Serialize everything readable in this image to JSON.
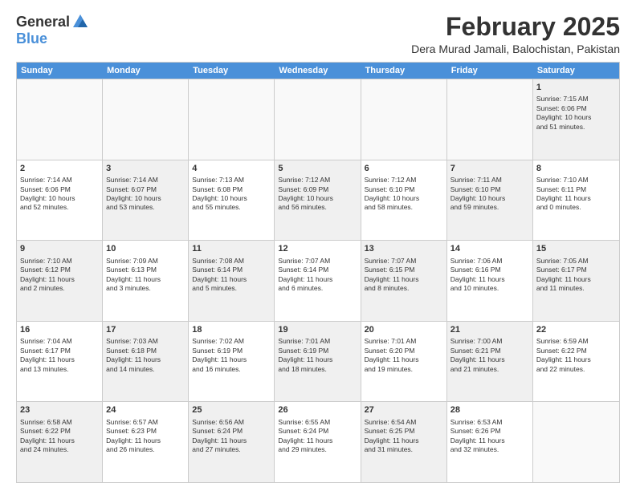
{
  "logo": {
    "general": "General",
    "blue": "Blue"
  },
  "title": "February 2025",
  "subtitle": "Dera Murad Jamali, Balochistan, Pakistan",
  "headers": [
    "Sunday",
    "Monday",
    "Tuesday",
    "Wednesday",
    "Thursday",
    "Friday",
    "Saturday"
  ],
  "rows": [
    [
      {
        "day": "",
        "text": "",
        "empty": true
      },
      {
        "day": "",
        "text": "",
        "empty": true
      },
      {
        "day": "",
        "text": "",
        "empty": true
      },
      {
        "day": "",
        "text": "",
        "empty": true
      },
      {
        "day": "",
        "text": "",
        "empty": true
      },
      {
        "day": "",
        "text": "",
        "empty": true
      },
      {
        "day": "1",
        "text": "Sunrise: 7:15 AM\nSunset: 6:06 PM\nDaylight: 10 hours\nand 51 minutes.",
        "shaded": true
      }
    ],
    [
      {
        "day": "2",
        "text": "Sunrise: 7:14 AM\nSunset: 6:06 PM\nDaylight: 10 hours\nand 52 minutes."
      },
      {
        "day": "3",
        "text": "Sunrise: 7:14 AM\nSunset: 6:07 PM\nDaylight: 10 hours\nand 53 minutes.",
        "shaded": true
      },
      {
        "day": "4",
        "text": "Sunrise: 7:13 AM\nSunset: 6:08 PM\nDaylight: 10 hours\nand 55 minutes."
      },
      {
        "day": "5",
        "text": "Sunrise: 7:12 AM\nSunset: 6:09 PM\nDaylight: 10 hours\nand 56 minutes.",
        "shaded": true
      },
      {
        "day": "6",
        "text": "Sunrise: 7:12 AM\nSunset: 6:10 PM\nDaylight: 10 hours\nand 58 minutes."
      },
      {
        "day": "7",
        "text": "Sunrise: 7:11 AM\nSunset: 6:10 PM\nDaylight: 10 hours\nand 59 minutes.",
        "shaded": true
      },
      {
        "day": "8",
        "text": "Sunrise: 7:10 AM\nSunset: 6:11 PM\nDaylight: 11 hours\nand 0 minutes."
      }
    ],
    [
      {
        "day": "9",
        "text": "Sunrise: 7:10 AM\nSunset: 6:12 PM\nDaylight: 11 hours\nand 2 minutes.",
        "shaded": true
      },
      {
        "day": "10",
        "text": "Sunrise: 7:09 AM\nSunset: 6:13 PM\nDaylight: 11 hours\nand 3 minutes."
      },
      {
        "day": "11",
        "text": "Sunrise: 7:08 AM\nSunset: 6:14 PM\nDaylight: 11 hours\nand 5 minutes.",
        "shaded": true
      },
      {
        "day": "12",
        "text": "Sunrise: 7:07 AM\nSunset: 6:14 PM\nDaylight: 11 hours\nand 6 minutes."
      },
      {
        "day": "13",
        "text": "Sunrise: 7:07 AM\nSunset: 6:15 PM\nDaylight: 11 hours\nand 8 minutes.",
        "shaded": true
      },
      {
        "day": "14",
        "text": "Sunrise: 7:06 AM\nSunset: 6:16 PM\nDaylight: 11 hours\nand 10 minutes."
      },
      {
        "day": "15",
        "text": "Sunrise: 7:05 AM\nSunset: 6:17 PM\nDaylight: 11 hours\nand 11 minutes.",
        "shaded": true
      }
    ],
    [
      {
        "day": "16",
        "text": "Sunrise: 7:04 AM\nSunset: 6:17 PM\nDaylight: 11 hours\nand 13 minutes."
      },
      {
        "day": "17",
        "text": "Sunrise: 7:03 AM\nSunset: 6:18 PM\nDaylight: 11 hours\nand 14 minutes.",
        "shaded": true
      },
      {
        "day": "18",
        "text": "Sunrise: 7:02 AM\nSunset: 6:19 PM\nDaylight: 11 hours\nand 16 minutes."
      },
      {
        "day": "19",
        "text": "Sunrise: 7:01 AM\nSunset: 6:19 PM\nDaylight: 11 hours\nand 18 minutes.",
        "shaded": true
      },
      {
        "day": "20",
        "text": "Sunrise: 7:01 AM\nSunset: 6:20 PM\nDaylight: 11 hours\nand 19 minutes."
      },
      {
        "day": "21",
        "text": "Sunrise: 7:00 AM\nSunset: 6:21 PM\nDaylight: 11 hours\nand 21 minutes.",
        "shaded": true
      },
      {
        "day": "22",
        "text": "Sunrise: 6:59 AM\nSunset: 6:22 PM\nDaylight: 11 hours\nand 22 minutes."
      }
    ],
    [
      {
        "day": "23",
        "text": "Sunrise: 6:58 AM\nSunset: 6:22 PM\nDaylight: 11 hours\nand 24 minutes.",
        "shaded": true
      },
      {
        "day": "24",
        "text": "Sunrise: 6:57 AM\nSunset: 6:23 PM\nDaylight: 11 hours\nand 26 minutes."
      },
      {
        "day": "25",
        "text": "Sunrise: 6:56 AM\nSunset: 6:24 PM\nDaylight: 11 hours\nand 27 minutes.",
        "shaded": true
      },
      {
        "day": "26",
        "text": "Sunrise: 6:55 AM\nSunset: 6:24 PM\nDaylight: 11 hours\nand 29 minutes."
      },
      {
        "day": "27",
        "text": "Sunrise: 6:54 AM\nSunset: 6:25 PM\nDaylight: 11 hours\nand 31 minutes.",
        "shaded": true
      },
      {
        "day": "28",
        "text": "Sunrise: 6:53 AM\nSunset: 6:26 PM\nDaylight: 11 hours\nand 32 minutes."
      },
      {
        "day": "",
        "text": "",
        "empty": true
      }
    ]
  ]
}
